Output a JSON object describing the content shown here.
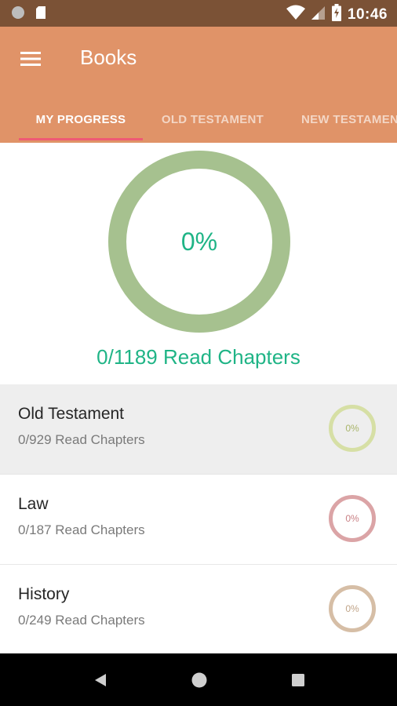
{
  "status_bar": {
    "time": "10:46",
    "icons": [
      "circle-notification-icon",
      "sd-card-icon",
      "wifi-icon",
      "cell-signal-icon",
      "battery-charging-icon"
    ]
  },
  "app_bar": {
    "title": "Books",
    "menu_icon": "hamburger-menu-icon",
    "color": "#e09368"
  },
  "tabs": [
    {
      "label": "MY PROGRESS",
      "active": true
    },
    {
      "label": "OLD TESTAMENT",
      "active": false
    },
    {
      "label": "NEW TESTAMENT",
      "active": false
    }
  ],
  "summary": {
    "percent_label": "0%",
    "progress_fraction": 0,
    "chapters_label": "0/1189 Read Chapters",
    "ring_color": "#a6c18f",
    "text_color": "#1fb486"
  },
  "list": [
    {
      "name": "Old Testament",
      "chapters": "0/929 Read Chapters",
      "percent_label": "0%",
      "progress_fraction": 0,
      "ring_color": "#d6dfa5",
      "text_color": "#a9b56a"
    },
    {
      "name": "Law",
      "chapters": "0/187 Read Chapters",
      "percent_label": "0%",
      "progress_fraction": 0,
      "ring_color": "#dba4a6",
      "text_color": "#c98085"
    },
    {
      "name": "History",
      "chapters": "0/249 Read Chapters",
      "percent_label": "0%",
      "progress_fraction": 0,
      "ring_color": "#d6bea6",
      "text_color": "#c0a488"
    }
  ],
  "nav_bar": {
    "icons": [
      "back-triangle-icon",
      "home-circle-icon",
      "recents-square-icon"
    ]
  }
}
